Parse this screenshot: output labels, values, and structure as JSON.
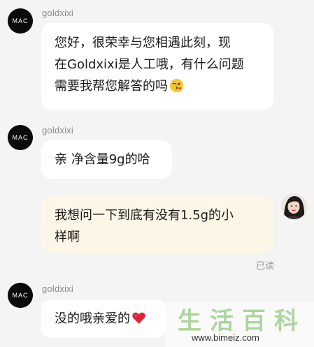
{
  "messages": [
    {
      "sender": "goldxixi",
      "lines": [
        "您好，很荣幸与您相遇此刻，现",
        "在Goldxixi是人工哦，有什么问题",
        "需要我帮您解答的吗"
      ],
      "emoji": "kissing-face-emoji"
    },
    {
      "sender": "goldxixi",
      "text": "亲 净含量9g的哈"
    },
    {
      "sender": "me",
      "lines": [
        "我想问一下到底有没有1.5g的小",
        "样啊"
      ],
      "status": "已读"
    },
    {
      "sender": "goldxixi",
      "text": "没的哦亲爱的",
      "emoji": "red-heart-emoji"
    }
  ],
  "avatar_brand": "MAC",
  "watermark": {
    "chars": [
      "生",
      "活",
      "百",
      "科"
    ],
    "url": "www.bimeiz.com"
  },
  "colors": {
    "background": "#f4f4f4",
    "incoming_bubble": "#ffffff",
    "outgoing_bubble": "#fdf6e6",
    "heart": "#e0243a"
  }
}
